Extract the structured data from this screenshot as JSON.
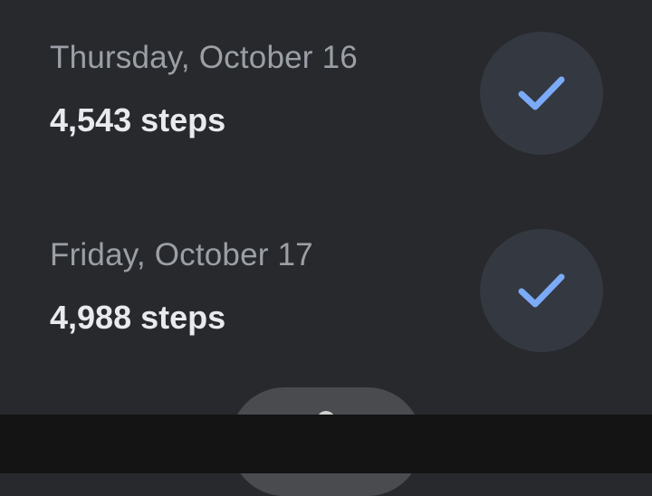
{
  "days": [
    {
      "date_label": "Thursday, October 16",
      "steps_label": "4,543 steps",
      "goal_met_icon": "check-icon"
    },
    {
      "date_label": "Friday, October 17",
      "steps_label": "4,988 steps",
      "goal_met_icon": "check-icon"
    }
  ],
  "colors": {
    "background": "#28292d",
    "date_text": "#9aa0a6",
    "steps_text": "#e8eaed",
    "check_circle": "#343841",
    "check_mark": "#7baaf7",
    "bottom_bar": "#141414"
  }
}
